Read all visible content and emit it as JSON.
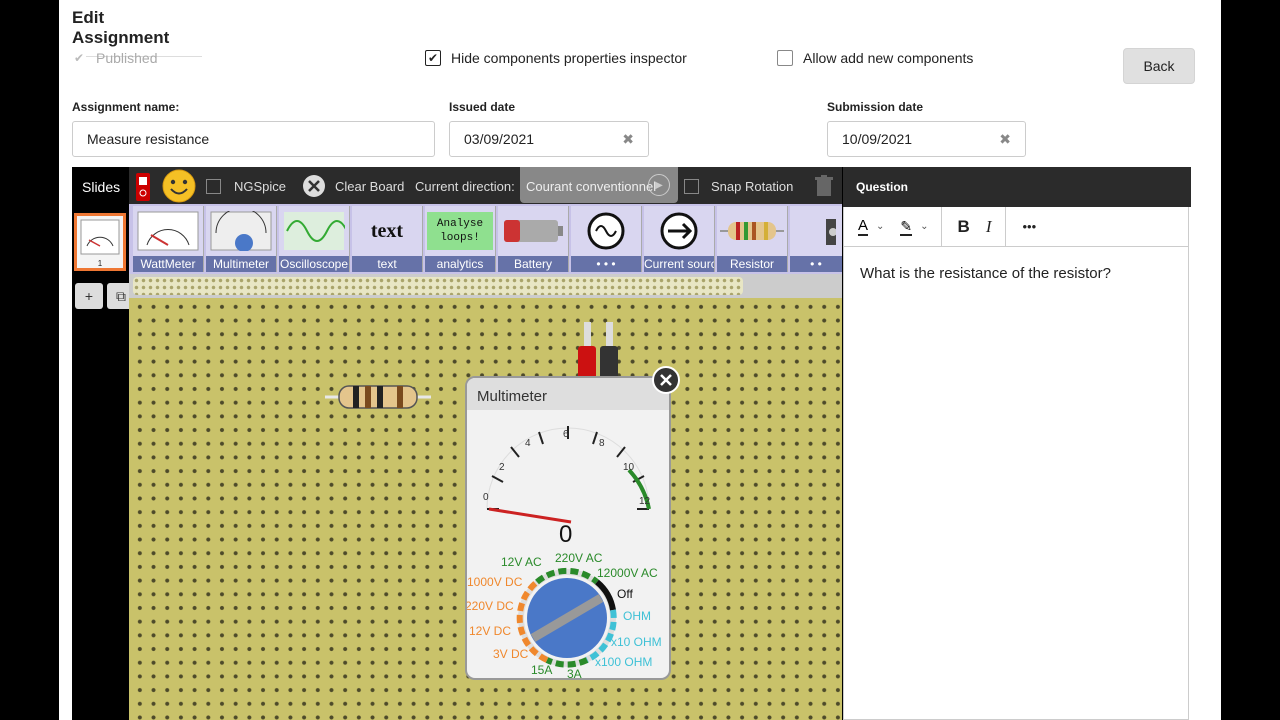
{
  "header": {
    "title": "Edit Assignment"
  },
  "options": {
    "published": "Published",
    "hide_inspector": "Hide components properties inspector",
    "allow_add": "Allow add new components"
  },
  "back_label": "Back",
  "fields": {
    "name_label": "Assignment name:",
    "name_value": "Measure resistance",
    "issued_label": "Issued date",
    "issued_value": "03/09/2021",
    "submission_label": "Submission date",
    "submission_value": "10/09/2021"
  },
  "slides": {
    "title": "Slides",
    "thumb_number": "1",
    "add": "+",
    "copy": "⧉"
  },
  "toolbar": {
    "ngspice": "NGSpice",
    "clear_board": "Clear Board",
    "current_direction": "Current direction:",
    "courant": "Courant conventionnel",
    "snap_rotation": "Snap Rotation"
  },
  "palette": [
    {
      "name": "WattMeter",
      "icon": "wattmeter-icon"
    },
    {
      "name": "Multimeter",
      "icon": "multimeter-icon"
    },
    {
      "name": "Oscilloscope",
      "icon": "sine-wave-icon"
    },
    {
      "name": "text",
      "icon": "text"
    },
    {
      "name": "analytics",
      "icon": "Analyse loops!"
    },
    {
      "name": "Battery",
      "icon": "battery-icon"
    },
    {
      "name": "• • •",
      "icon": "ac-source-icon"
    },
    {
      "name": "Current source",
      "icon": "arrow-circle-icon"
    },
    {
      "name": "Resistor",
      "icon": "resistor-icon"
    },
    {
      "name": "• •",
      "icon": "more-icon"
    }
  ],
  "multimeter": {
    "title": "Multimeter",
    "reading": "0",
    "scale": [
      "0",
      "2",
      "4",
      "6",
      "8",
      "10",
      "12"
    ],
    "ranges": [
      "12V AC",
      "220V AC",
      "12000V AC",
      "Off",
      "OHM",
      "x10 OHM",
      "x100 OHM",
      "3A",
      "15A",
      "3V DC",
      "12V DC",
      "220V DC",
      "1000V DC"
    ]
  },
  "question": {
    "header": "Question",
    "text": "What is the resistance of the resistor?",
    "bold": "B",
    "italic": "I",
    "more": "•••"
  }
}
